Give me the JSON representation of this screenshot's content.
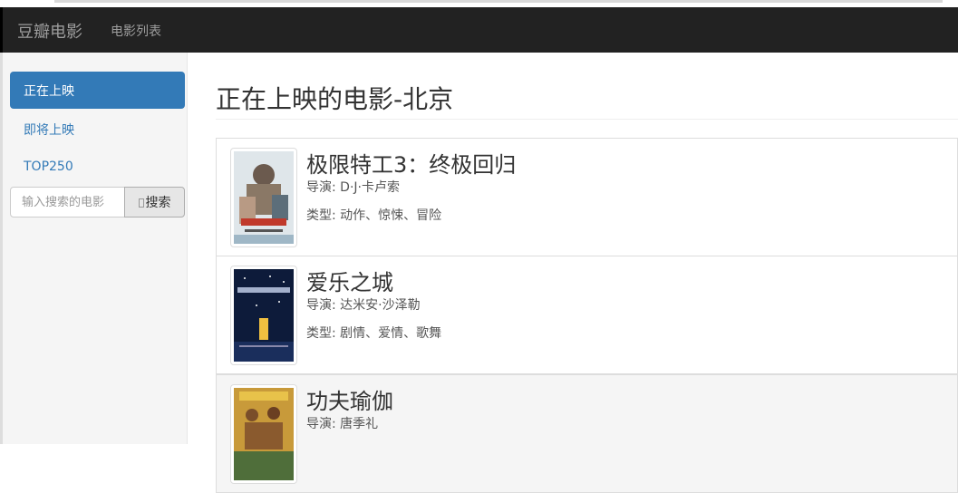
{
  "navbar": {
    "brand": "豆瓣电影",
    "link": "电影列表"
  },
  "sidebar": {
    "items": [
      {
        "label": "正在上映",
        "active": true
      },
      {
        "label": "即将上映",
        "active": false
      },
      {
        "label": "TOP250",
        "active": false
      }
    ],
    "search": {
      "placeholder": "输入搜索的电影",
      "button_label": "搜索"
    }
  },
  "main": {
    "title": "正在上映的电影-北京",
    "director_label": "导演: ",
    "genre_label": "类型: ",
    "movies": [
      {
        "title": "极限特工3：终极回归",
        "director": "D·J·卡卢索",
        "genres": "动作、惊悚、冒险",
        "poster": "poster-xxx-icon"
      },
      {
        "title": "爱乐之城",
        "director": "达米安·沙泽勒",
        "genres": "剧情、爱情、歌舞",
        "poster": "poster-lalaland-icon"
      },
      {
        "title": "功夫瑜伽",
        "director": "唐季礼",
        "genres": "",
        "poster": "poster-kungfu-yoga-icon"
      }
    ]
  },
  "colors": {
    "navbar_bg": "#222222",
    "active": "#337ab7",
    "sidebar_bg": "#f5f5f5"
  }
}
